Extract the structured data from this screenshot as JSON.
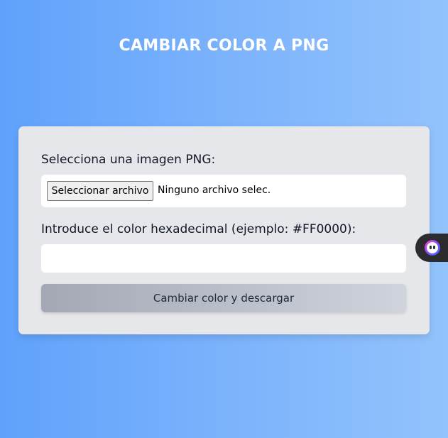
{
  "page": {
    "title": "CAMBIAR COLOR A PNG"
  },
  "form": {
    "file_label": "Selecciona una imagen PNG:",
    "file_button_label": "Seleccionar archivo",
    "file_status": "Ninguno archivo selec.",
    "color_label": "Introduce el color hexadecimal (ejemplo: #FF0000):",
    "color_value": "",
    "submit_label": "Cambiar color y descargar"
  },
  "widget": {
    "icon": "assistant-face-icon"
  },
  "colors": {
    "background_start": "#5fa2fb",
    "background_end": "#93c3fc",
    "card": "#e6e7ea",
    "button_start": "#a3a8b4",
    "button_end": "#cfd3db"
  }
}
